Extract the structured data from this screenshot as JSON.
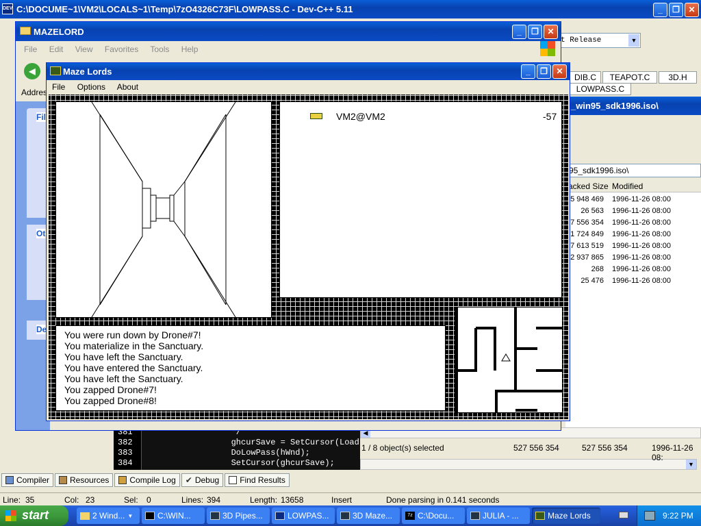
{
  "devcpp": {
    "title": "C:\\DOCUME~1\\VM2\\LOCALS~1\\Temp\\7zO4326C73F\\LOWPASS.C - Dev-C++ 5.11",
    "config": "t Release",
    "tabs": [
      "DIB.C",
      "TEAPOT.C",
      "3D.H"
    ],
    "active_tab": "LOWPASS.C",
    "code_lines": [
      {
        "num": "381",
        "text": "   */"
      },
      {
        "num": "382",
        "text": "   ghcurSave = SetCursor(Load"
      },
      {
        "num": "383",
        "text": "   DoLowPass(hWnd);"
      },
      {
        "num": "384",
        "text": "   SetCursor(ghcurSave);"
      }
    ],
    "bottom_tabs": [
      "Compiler",
      "Resources",
      "Compile Log",
      "Debug",
      "Find Results"
    ],
    "status": {
      "line_label": "Line:",
      "line": "35",
      "col_label": "Col:",
      "col": "23",
      "sel_label": "Sel:",
      "sel": "0",
      "lines_label": "Lines:",
      "lines": "394",
      "length_label": "Length:",
      "length": "13658",
      "mode": "Insert",
      "message": "Done parsing in 0.141 seconds"
    }
  },
  "zip": {
    "path_title": "_win95_sdk1996.iso\\",
    "path": "95_sdk1996.iso\\",
    "col_packed": "acked Size",
    "col_modified": "Modified",
    "rows": [
      {
        "size": "5 948 469",
        "date": "1996-11-26 08:00"
      },
      {
        "size": "26 563",
        "date": "1996-11-26 08:00"
      },
      {
        "size": "7 556 354",
        "date": "1996-11-26 08:00"
      },
      {
        "size": "1 724 849",
        "date": "1996-11-26 08:00"
      },
      {
        "size": "7 613 519",
        "date": "1996-11-26 08:00"
      },
      {
        "size": "2 937 865",
        "date": "1996-11-26 08:00"
      },
      {
        "size": "268",
        "date": "1996-11-26 08:00"
      },
      {
        "size": "25 476",
        "date": "1996-11-26 08:00"
      }
    ],
    "status": {
      "selected": "1 / 8 object(s) selected",
      "size1": "527 556 354",
      "size2": "527 556 354",
      "date": "1996-11-26 08:"
    }
  },
  "explorer": {
    "title": "MAZELORD",
    "menu": [
      "File",
      "Edit",
      "View",
      "Favorites",
      "Tools",
      "Help"
    ],
    "address": "Address",
    "sidebar": [
      "File",
      "Oth",
      "De"
    ]
  },
  "mazelords": {
    "title": "Maze Lords",
    "menu": [
      "File",
      "Options",
      "About"
    ],
    "player": {
      "name": "VM2@VM2",
      "score": "-57"
    },
    "messages": [
      "You were run down by Drone#7!",
      "You materialize in the Sanctuary.",
      "You have left the Sanctuary.",
      "You have entered the Sanctuary.",
      "You have left the Sanctuary.",
      "You zapped Drone#7!",
      "You zapped Drone#8!"
    ]
  },
  "taskbar": {
    "start": "start",
    "items": [
      {
        "label": "2 Wind...",
        "icon": "folder-icon"
      },
      {
        "label": "C:\\WIN...",
        "icon": "console-icon"
      },
      {
        "label": "3D Pipes...",
        "icon": "app-icon"
      },
      {
        "label": "LOWPAS...",
        "icon": "devcpp-icon"
      },
      {
        "label": "3D Maze...",
        "icon": "app-icon"
      },
      {
        "label": "C:\\Docu...",
        "icon": "7zip-icon"
      },
      {
        "label": "JULIA - ...",
        "icon": "app-icon"
      },
      {
        "label": "Maze Lords",
        "icon": "mazelords-icon"
      }
    ],
    "clock": "9:22 PM"
  },
  "colors": {
    "xp_blue": "#0a4ac4",
    "taskbar": "#245edb",
    "start_green": "#3c9a3c"
  }
}
